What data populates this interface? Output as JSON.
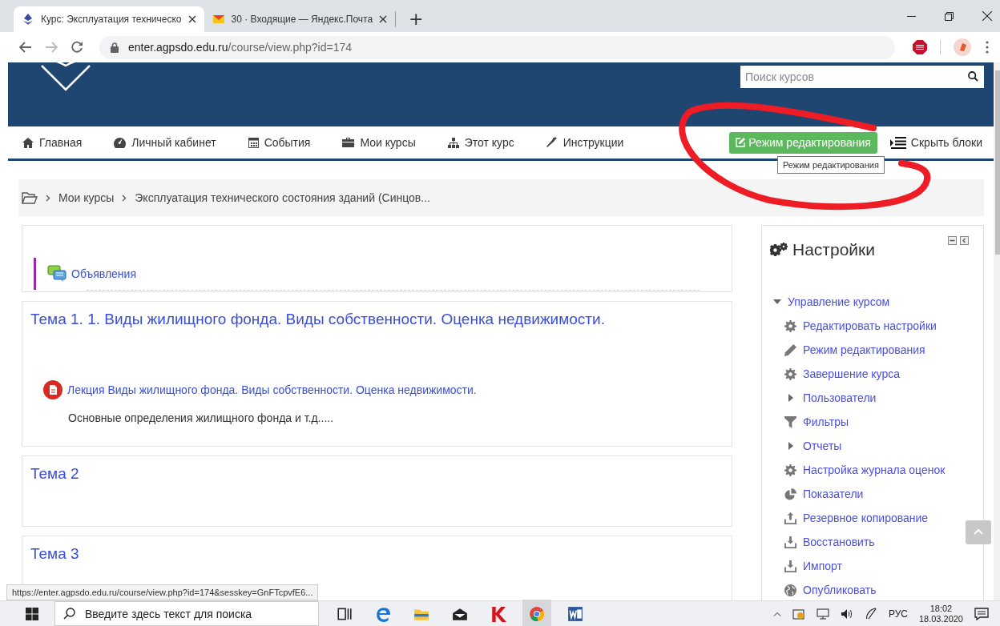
{
  "browser": {
    "tabs": [
      {
        "title": "Курс: Эксплуатация техническо",
        "selected": true
      },
      {
        "title": "30 · Входящие — Яндекс.Почта",
        "selected": false
      }
    ],
    "new_tab": "+",
    "address": {
      "domain": "enter.agpsdo.edu.ru",
      "path": "/course/view.php?id=174"
    },
    "status_url": "https://enter.agpsdo.edu.ru/course/view.php?id=174&sesskey=GnFTcpvfE6..."
  },
  "header": {
    "search": {
      "placeholder": "Поиск курсов"
    }
  },
  "nav": {
    "items": [
      {
        "label": "Главная"
      },
      {
        "label": "Личный кабинет"
      },
      {
        "label": "События"
      },
      {
        "label": "Мои курсы"
      },
      {
        "label": "Этот курс"
      },
      {
        "label": "Инструкции"
      }
    ],
    "edit_button": "Режим редактирования",
    "hide_blocks": "Скрыть блоки",
    "tooltip": "Режим редактирования"
  },
  "breadcrumb": [
    "Мои курсы",
    "Эксплуатация технического состояния зданий (Синцов..."
  ],
  "sections": [
    {
      "kind": "intro",
      "activities": [
        {
          "kind": "forum",
          "label": "Объявления"
        }
      ]
    },
    {
      "kind": "topic",
      "title": "Тема 1. 1. Виды жилищного фонда. Виды собственности. Оценка недвижимости.",
      "activities": [
        {
          "kind": "pdf",
          "label": "Лекция Виды жилищного фонда. Виды собственности. Оценка недвижимости.",
          "description": "Основные определения жилищного фонда  и т.д....."
        }
      ]
    },
    {
      "kind": "topic",
      "title": "Тема 2"
    },
    {
      "kind": "topic",
      "title": "Тема 3"
    }
  ],
  "settings": {
    "title": "Настройки",
    "tree": {
      "label": "Управление курсом",
      "expanded": true,
      "children": [
        {
          "kind": "leaf",
          "label": "Редактировать настройки"
        },
        {
          "kind": "leaf",
          "label": "Режим редактирования"
        },
        {
          "kind": "leaf",
          "label": "Завершение курса"
        },
        {
          "kind": "branch",
          "label": "Пользователи",
          "expanded": false
        },
        {
          "kind": "leaf",
          "label": "Фильтры"
        },
        {
          "kind": "branch",
          "label": "Отчеты",
          "expanded": false
        },
        {
          "kind": "leaf",
          "label": "Настройка журнала оценок"
        },
        {
          "kind": "leaf",
          "label": "Показатели"
        },
        {
          "kind": "leaf",
          "label": "Резервное копирование"
        },
        {
          "kind": "leaf",
          "label": "Восстановить"
        },
        {
          "kind": "leaf",
          "label": "Импорт"
        },
        {
          "kind": "leaf",
          "label": "Опубликовать"
        }
      ]
    }
  },
  "taskbar": {
    "search": {
      "placeholder": "Введите здесь текст для поиска"
    },
    "language": "РУС",
    "time": "18:02",
    "date": "18.03.2020"
  }
}
